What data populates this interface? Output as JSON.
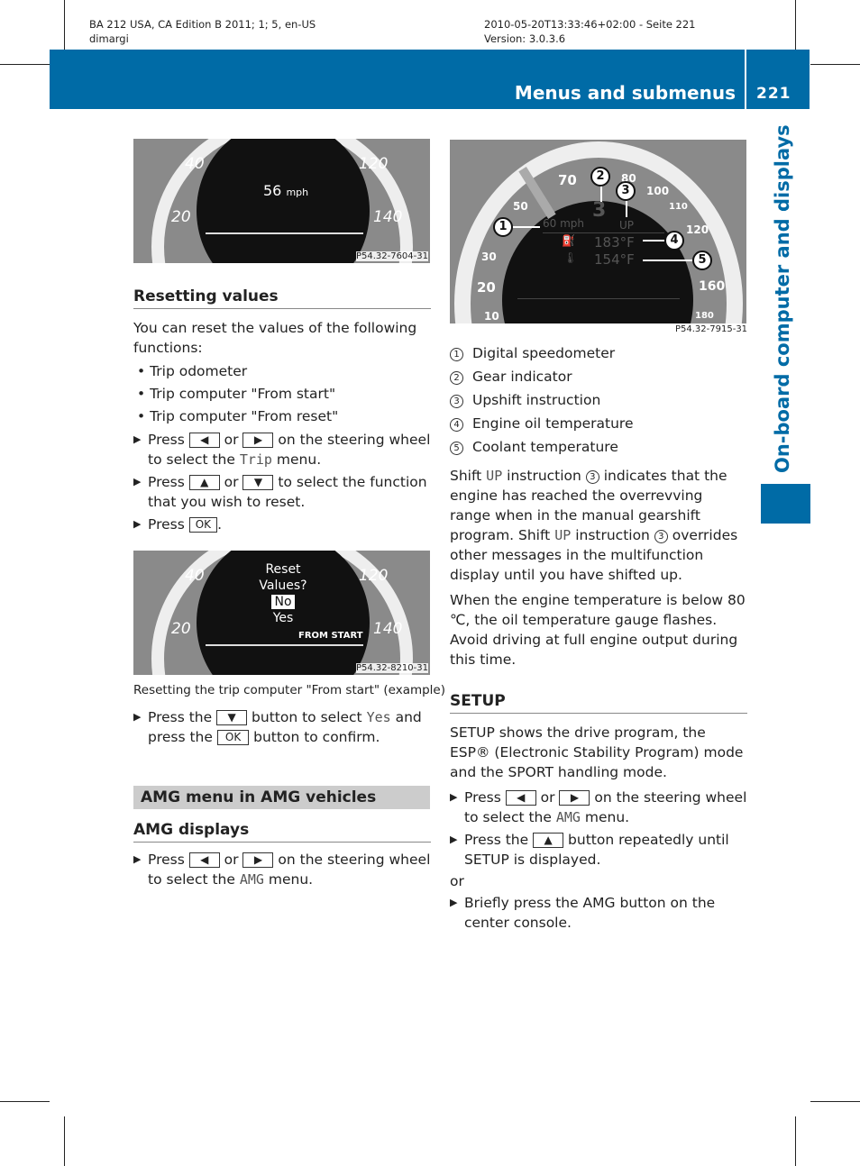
{
  "meta": {
    "left_line1": "BA 212 USA, CA Edition B 2011; 1; 5, en-US",
    "left_line2": "dimargi",
    "right_line1": "2010-05-20T13:33:46+02:00 - Seite 221",
    "right_line2": "Version: 3.0.3.6"
  },
  "header": {
    "title": "Menus and submenus",
    "page": "221",
    "color": "#006ba6"
  },
  "side_tab": "On-board computer and displays",
  "fig1": {
    "left_nums": [
      "40",
      "20"
    ],
    "right_nums": [
      "120",
      "140"
    ],
    "speed": "56",
    "unit": "mph",
    "code": "P54.32-7604-31"
  },
  "reset": {
    "heading": "Resetting values",
    "intro": "You can reset the values of the following functions:",
    "bullets": [
      "• Trip odometer",
      "• Trip computer \"From start\"",
      "• Trip computer \"From reset\""
    ],
    "step1": {
      "a": "Press",
      "key1": "◀",
      "or": "or",
      "key2": "▶",
      "b": "on the steering wheel to select the",
      "menu": "Trip",
      "c": "menu."
    },
    "step2": {
      "a": "Press",
      "key1": "▲",
      "or": "or",
      "key2": "▼",
      "b": "to select the function that you wish to reset."
    },
    "step3": {
      "a": "Press",
      "key": "OK",
      "b": "."
    }
  },
  "fig2": {
    "left_nums": [
      "40",
      "20"
    ],
    "right_nums": [
      "120",
      "140"
    ],
    "l1": "Reset",
    "l2": "Values?",
    "no": "No",
    "yes": "Yes",
    "from": "FROM START",
    "code": "P54.32-8210-31",
    "caption": "Resetting the trip computer \"From start\" (example)"
  },
  "after": {
    "a": "Press the",
    "key": "▼",
    "b": "button to select",
    "yes": "Yes",
    "c": "and press the",
    "key2": "OK",
    "d": "button to confirm."
  },
  "amg_menu": {
    "heading": "AMG menu in AMG vehicles",
    "sub": "AMG displays",
    "a": "Press",
    "key1": "◀",
    "or": "or",
    "key2": "▶",
    "b": "on the steering wheel to select the",
    "menu": "AMG",
    "c": "menu."
  },
  "fig3": {
    "scale": [
      "70",
      "80",
      "100",
      "110",
      "120",
      "50",
      "30",
      "20",
      "10",
      "160",
      "180"
    ],
    "speed": "60 mph",
    "gear": "3",
    "up": "UP",
    "oil": "183°F",
    "coolant": "154°F",
    "code": "P54.32-7915-31",
    "callouts": [
      "1",
      "2",
      "3",
      "4",
      "5"
    ]
  },
  "legend": [
    {
      "n": "1",
      "t": "Digital speedometer"
    },
    {
      "n": "2",
      "t": "Gear indicator"
    },
    {
      "n": "3",
      "t": "Upshift instruction"
    },
    {
      "n": "4",
      "t": "Engine oil temperature"
    },
    {
      "n": "5",
      "t": "Coolant temperature"
    }
  ],
  "shift": {
    "a": "Shift",
    "up": "UP",
    "b": "instruction",
    "n": "3",
    "c": "indicates that the engine has reached the overrevving range when in the manual gearshift program. Shift",
    "up2": "UP",
    "d": "instruction",
    "n2": "3",
    "e": "overrides other messages in the multifunction display until you have shifted up."
  },
  "temp": "When the engine temperature is below 80 ℃, the oil temperature gauge flashes. Avoid driving at full engine output during this time.",
  "setup": {
    "heading": "SETUP",
    "intro": "SETUP shows the drive program, the ESP® (Electronic Stability Program) mode and the SPORT handling mode.",
    "s1": {
      "a": "Press",
      "key1": "◀",
      "or": "or",
      "key2": "▶",
      "b": "on the steering wheel to select the",
      "menu": "AMG",
      "c": "menu."
    },
    "s2": {
      "a": "Press the",
      "key": "▲",
      "b": "button repeatedly until SETUP is displayed."
    },
    "or": "or",
    "s3": "Briefly press the AMG button on the center console."
  }
}
